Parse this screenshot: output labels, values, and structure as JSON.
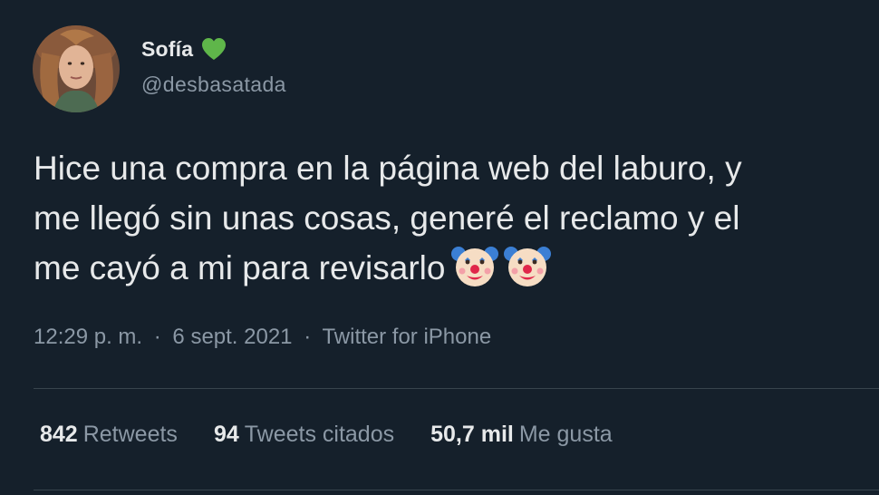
{
  "author": {
    "display_name": "Sofía",
    "handle": "@desbasatada",
    "badge_icon": "green-heart-icon",
    "badge_color": "#5fb64a"
  },
  "tweet": {
    "lines": [
      "Hice una compra en la página web del laburo, y",
      "me llegó sin unas cosas, generé el reclamo y el",
      "me cayó a mi para revisarlo"
    ],
    "emojis": [
      "clown-face-icon",
      "clown-face-icon"
    ]
  },
  "meta": {
    "time": "12:29 p. m.",
    "separator": "·",
    "date": "6 sept. 2021",
    "source": "Twitter for iPhone"
  },
  "stats": {
    "retweets": {
      "count": "842",
      "label": "Retweets"
    },
    "quotes": {
      "count": "94",
      "label": "Tweets citados"
    },
    "likes": {
      "count": "50,7 mil",
      "label": "Me gusta"
    }
  },
  "colors": {
    "background": "#15202b",
    "text_primary": "#e7e9ea",
    "text_secondary": "#8b98a5",
    "divider": "#38444d"
  }
}
